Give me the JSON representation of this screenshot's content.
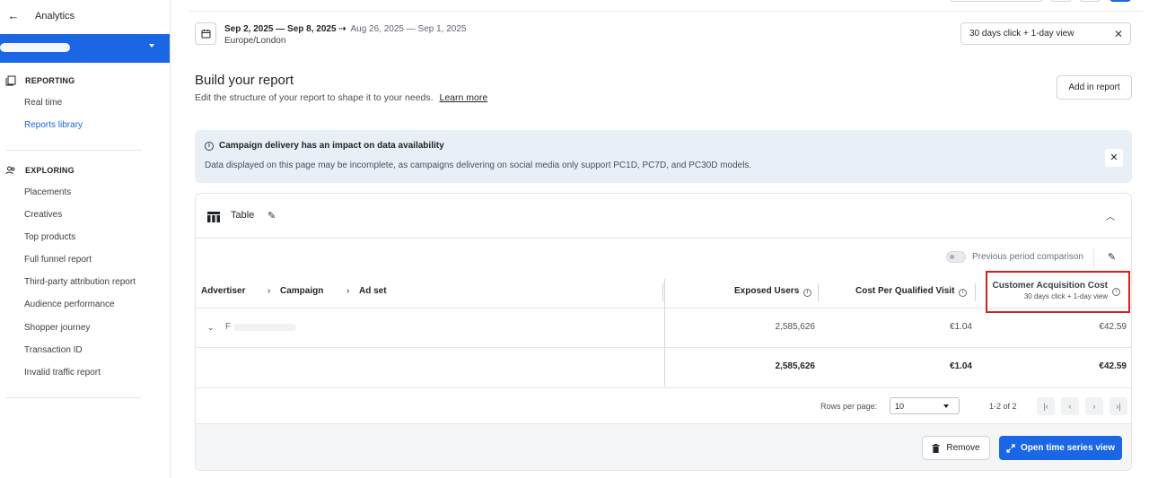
{
  "sidebar": {
    "title": "Analytics",
    "sections": [
      {
        "heading": "REPORTING",
        "items": [
          "Real time",
          "Reports library"
        ]
      },
      {
        "heading": "EXPLORING",
        "items": [
          "Placements",
          "Creatives",
          "Top products",
          "Full funnel report",
          "Third-party attribution report",
          "Audience performance",
          "Shopper journey",
          "Transaction ID",
          "Invalid traffic report"
        ]
      }
    ],
    "active_item": "Reports library"
  },
  "date_range": {
    "main": "Sep 2, 2025 — Sep 8, 2025",
    "compare": "Aug 26, 2025 — Sep 1, 2025",
    "timezone": "Europe/London"
  },
  "attribution": {
    "value": "30 days click + 1-day view"
  },
  "builder": {
    "title": "Build your report",
    "subtitle": "Edit the structure of your report to shape it to your needs.",
    "learn_more": "Learn more",
    "add_button": "Add in report"
  },
  "banner": {
    "title": "Campaign delivery has an impact on data availability",
    "text": "Data displayed on this page may be incomplete, as campaigns delivering on social media only support PC1D, PC7D, and PC30D models."
  },
  "table": {
    "label": "Table",
    "comparison_label": "Previous period comparison",
    "dimensions": [
      "Advertiser",
      "Campaign",
      "Ad set"
    ],
    "metrics": [
      {
        "name": "Exposed Users",
        "sub": ""
      },
      {
        "name": "Cost Per Qualified Visit",
        "sub": ""
      },
      {
        "name": "Customer Acquisition Cost",
        "sub": "30 days click + 1-day view"
      }
    ],
    "row": {
      "label": "F",
      "values": [
        "2,585,626",
        "€1.04",
        "€42.59"
      ]
    },
    "totals": [
      "2,585,626",
      "€1.04",
      "€42.59"
    ]
  },
  "pagination": {
    "rows_label": "Rows per page:",
    "rows_value": "10",
    "range": "1-2 of 2"
  },
  "actions": {
    "remove": "Remove",
    "open": "Open time series view"
  },
  "colors": {
    "accent": "#1a66e5",
    "highlight": "#d42020",
    "banner_bg": "#e9eff6"
  }
}
